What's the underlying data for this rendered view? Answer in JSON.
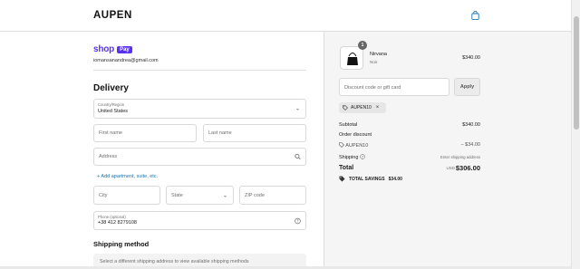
{
  "header": {
    "brand": "AUPEN"
  },
  "express": {
    "shop_word": "shop",
    "pay_badge": "Pay",
    "email": "iomansanandrea@gmail.com"
  },
  "delivery": {
    "title": "Delivery",
    "country": {
      "label": "Country/Region",
      "value": "United States"
    },
    "first_name": {
      "placeholder": "First name"
    },
    "last_name": {
      "placeholder": "Last name"
    },
    "address": {
      "placeholder": "Address"
    },
    "add_link": "+ Add apartment, suite, etc.",
    "city": {
      "placeholder": "City"
    },
    "state": {
      "placeholder": "State"
    },
    "zip": {
      "placeholder": "ZIP code"
    },
    "phone": {
      "label": "Phone (optional)",
      "value": "+38 412 8279108"
    }
  },
  "shipping_method": {
    "title": "Shipping method",
    "message": "Select a different shipping address to view available shipping methods"
  },
  "summary": {
    "product": {
      "quantity": "1",
      "name": "Nirvana",
      "variant": "Noir",
      "price": "$340.00"
    },
    "discount_placeholder": "Discount code or gift card",
    "apply_label": "Apply",
    "applied_code": "AUPEN10",
    "subtotal_label": "Subtotal",
    "subtotal_value": "$340.00",
    "order_discount_label": "Order discount",
    "discount_code": "AUPEN10",
    "discount_value": "– $34.00",
    "shipping_label": "Shipping",
    "shipping_value": "Enter shipping address",
    "total_label": "Total",
    "currency": "USD",
    "total_value": "$306.00",
    "savings_label": "TOTAL SAVINGS",
    "savings_value": "$34.00"
  },
  "colors": {
    "shop_purple": "#5a31f4",
    "link_blue": "#1773b0",
    "summary_bg": "#f5f5f5"
  }
}
